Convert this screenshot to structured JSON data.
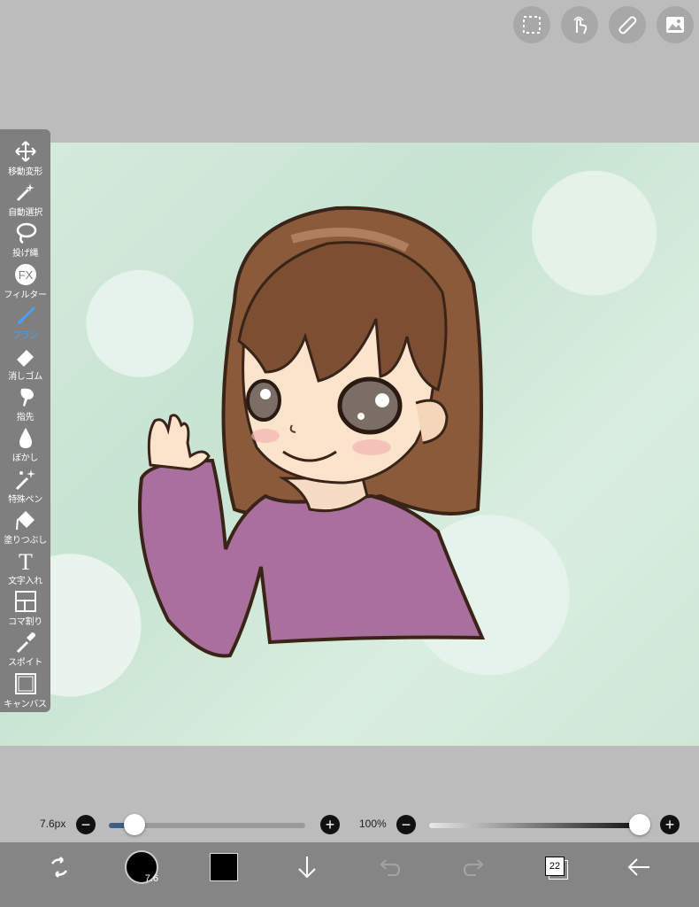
{
  "tools": [
    {
      "label": "移動変形",
      "icon": "move-icon"
    },
    {
      "label": "自動選択",
      "icon": "magic-wand-icon"
    },
    {
      "label": "投げ縄",
      "icon": "lasso-icon"
    },
    {
      "label": "フィルター",
      "icon": "fx-icon",
      "badge": "FX"
    },
    {
      "label": "ブラシ",
      "icon": "brush-icon",
      "active": true
    },
    {
      "label": "消しゴム",
      "icon": "eraser-icon"
    },
    {
      "label": "指先",
      "icon": "finger-icon"
    },
    {
      "label": "ぼかし",
      "icon": "blur-drop-icon"
    },
    {
      "label": "特殊ペン",
      "icon": "special-pen-icon"
    },
    {
      "label": "塗りつぶし",
      "icon": "fill-bucket-icon"
    },
    {
      "label": "文字入れ",
      "icon": "text-icon",
      "glyph": "T"
    },
    {
      "label": "コマ割り",
      "icon": "frame-divider-icon"
    },
    {
      "label": "スポイト",
      "icon": "eyedropper-icon"
    },
    {
      "label": "キャンバス",
      "icon": "canvas-icon"
    }
  ],
  "brush": {
    "size_label": "7.6px",
    "size_value": 7.6,
    "size_fraction": 0.13,
    "minus": "−",
    "plus": "+"
  },
  "opacity": {
    "label": "100%",
    "value": 1.0,
    "minus": "−",
    "plus": "+"
  },
  "bottom": {
    "brush_size_badge": "7.6",
    "layer_count": "22",
    "current_color": "#000000"
  },
  "colors": {
    "active_tool": "#4aa0ef",
    "toolbar_bg": "#7f7f7f",
    "bottom_bar": "#858585"
  }
}
